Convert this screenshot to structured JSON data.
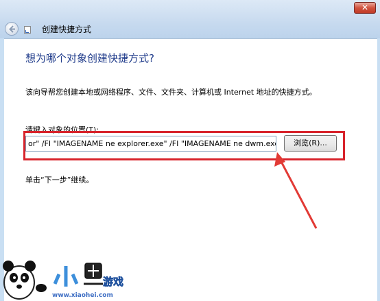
{
  "window": {
    "title": "创建快捷方式",
    "close_label": "✕"
  },
  "page": {
    "heading": "想为哪个对象创建快捷方式?",
    "description": "该向导帮您创建本地或网络程序、文件、文件夹、计算机或 Internet 地址的快捷方式。",
    "location_label": "请键入对象的位置(T):",
    "location_value": "or\" /FI \"IMAGENAME ne explorer.exe\" /FI \"IMAGENAME ne dwm.exe",
    "browse_label": "浏览(R)...",
    "hint": "单击“下一步”继续。"
  },
  "watermark": {
    "logo_text": "小黑游戏",
    "site": "www.xiaohei.com"
  },
  "colors": {
    "highlight": "#d8242c",
    "heading": "#1e3a8a",
    "titlebar": "#c7daef"
  },
  "icons": [
    "back-arrow-icon",
    "shortcut-app-icon",
    "close-icon",
    "panda-icon"
  ]
}
